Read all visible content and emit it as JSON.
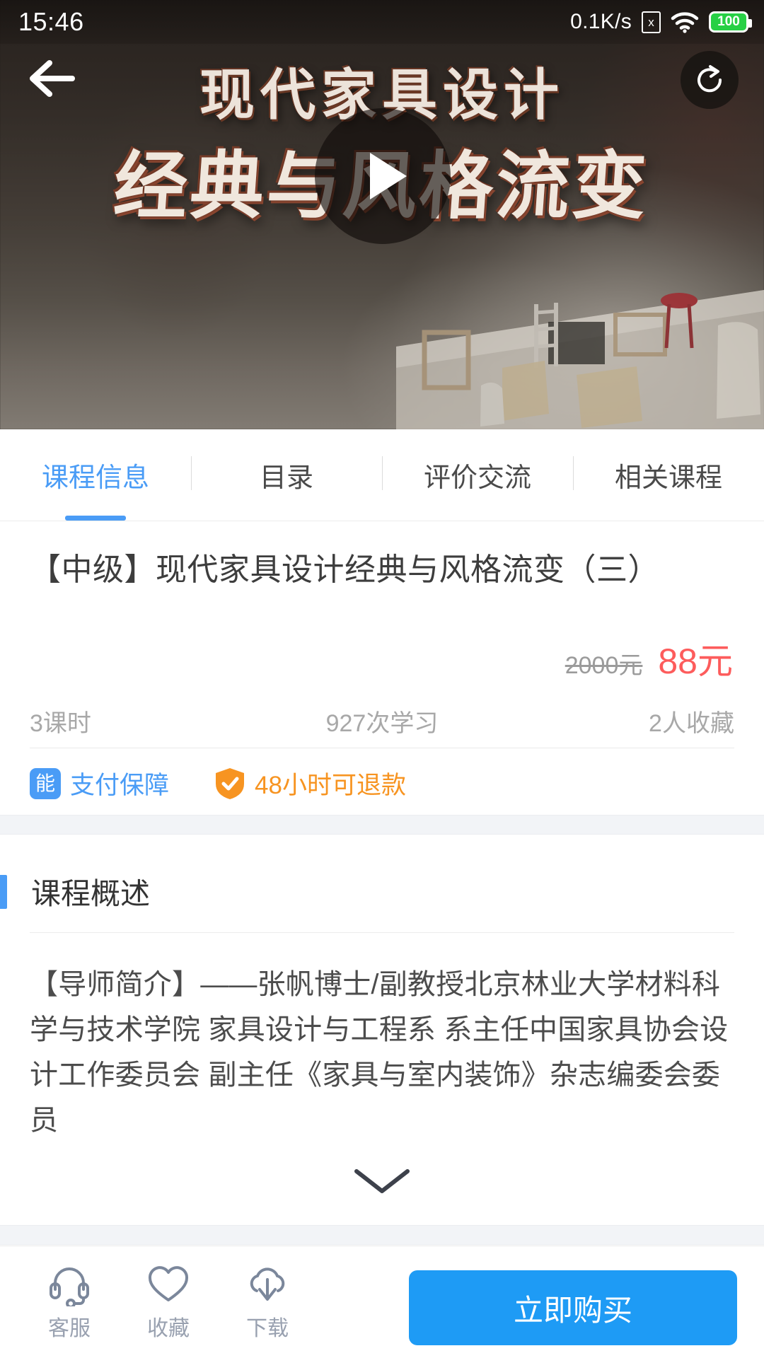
{
  "status_bar": {
    "time": "15:46",
    "network_speed": "0.1K/s",
    "sim_icon": "sim-card-disabled-icon",
    "sim_glyph": "x",
    "wifi_icon": "wifi-icon",
    "battery_level": "100"
  },
  "hero": {
    "title_top": "现代家具设计",
    "title_bottom": "经典与风格流变",
    "back_icon": "back-arrow-icon",
    "share_icon": "share-icon",
    "play_icon": "play-icon"
  },
  "tabs": [
    {
      "label": "课程信息",
      "active": true
    },
    {
      "label": "目录",
      "active": false
    },
    {
      "label": "评价交流",
      "active": false
    },
    {
      "label": "相关课程",
      "active": false
    }
  ],
  "course": {
    "title": "【中级】现代家具设计经典与风格流变（三）",
    "price_original": "2000元",
    "price_current": "88元",
    "lessons": "3课时",
    "learners": "927次学习",
    "favorites": "2人收藏"
  },
  "badges": {
    "pay_icon_glyph": "能",
    "pay_label": "支付保障",
    "refund_icon": "shield-check-icon",
    "refund_label": "48小时可退款"
  },
  "overview": {
    "section_title": "课程概述",
    "description": "【导师简介】——张帆博士/副教授北京林业大学材料科学与技术学院 家具设计与工程系 系主任中国家具协会设计工作委员会 副主任《家具与室内装饰》杂志编委会委员",
    "expand_icon": "chevron-down-icon"
  },
  "bottom_bar": {
    "actions": [
      {
        "icon": "headset-icon",
        "label": "客服"
      },
      {
        "icon": "heart-icon",
        "label": "收藏"
      },
      {
        "icon": "cloud-download-icon",
        "label": "下载"
      }
    ],
    "buy_label": "立即购买"
  },
  "colors": {
    "accent_blue": "#4a9cf6",
    "buy_blue": "#1e9bf5",
    "price_red": "#fd5c5c",
    "refund_orange": "#f79421",
    "battery_green": "#27d045"
  }
}
